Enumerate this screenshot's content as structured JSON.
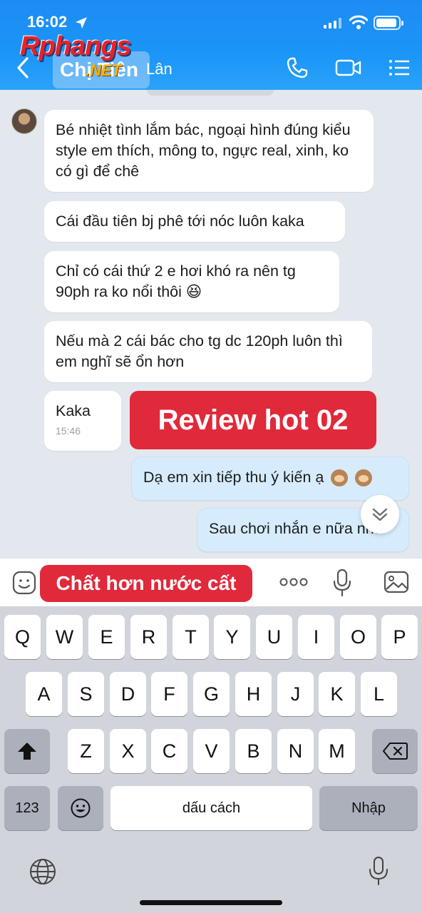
{
  "status": {
    "time": "16:02"
  },
  "header": {
    "title": "Chị Tiên",
    "title_rest": "Lân",
    "logo_text": "Rphangs",
    "logo_net": ".NET"
  },
  "messages": [
    {
      "text": "Bé nhiệt tình lắm bác, ngoại hình đúng kiểu style em thích, mông to, ngực real, xinh, ko có gì để chê",
      "sender": "other"
    },
    {
      "text": "Cái đầu tiên bj phê tới nóc luôn kaka",
      "sender": "other"
    },
    {
      "text": "Chỉ có cái thứ 2 e hơi khó ra nên tg 90ph ra ko nổi thôi 😆",
      "sender": "other"
    },
    {
      "text": "Nếu mà 2 cái bác cho tg dc 120ph luôn thì em nghĩ sẽ ổn hơn",
      "sender": "other"
    },
    {
      "text": "Kaka",
      "time": "15:46",
      "sender": "other"
    },
    {
      "text": "Dạ em xin tiếp thu ý kiến ạ",
      "sender": "me"
    },
    {
      "text": "Sau chơi nhắn e nữa nha",
      "sender": "me"
    }
  ],
  "overlays": {
    "review": "Review hot 02",
    "input": "Chất hơn nước cất"
  },
  "keyboard": {
    "row1": [
      "Q",
      "W",
      "E",
      "R",
      "T",
      "Y",
      "U",
      "I",
      "O",
      "P"
    ],
    "row2": [
      "A",
      "S",
      "D",
      "F",
      "G",
      "H",
      "J",
      "K",
      "L"
    ],
    "row3": [
      "Z",
      "X",
      "C",
      "V",
      "B",
      "N",
      "M"
    ],
    "numbers": "123",
    "space": "dấu cách",
    "return": "Nhập"
  },
  "colors": {
    "header": "#1b95f7",
    "overlay_red": "#e0293a",
    "my_bubble": "#d6ecfc",
    "chat_bg": "#e3e8ee"
  }
}
